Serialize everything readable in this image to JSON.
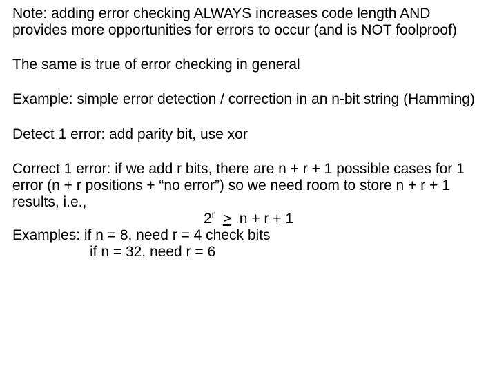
{
  "p1": "Note:  adding error checking ALWAYS increases code length AND provides more opportunities for errors to occur (and is NOT foolproof)",
  "p2": "The same is true of error checking in general",
  "p3": "Example:  simple error detection / correction in an n-bit string (Hamming)",
  "p4": "Detect 1 error:  add parity bit, use xor",
  "p5": "Correct 1 error:  if we add r bits, there are n + r + 1 possible cases for 1 error (n + r positions + “no error”) so we need room to store n + r + 1 results, i.e.,",
  "formula_pre": "2",
  "formula_sup": "r",
  "formula_gap": "  ",
  "formula_op": ">",
  "formula_post": "  n + r + 1",
  "p6": "Examples:  if n = 8, need r = 4 check bits",
  "p7": "if n = 32, need r = 6"
}
